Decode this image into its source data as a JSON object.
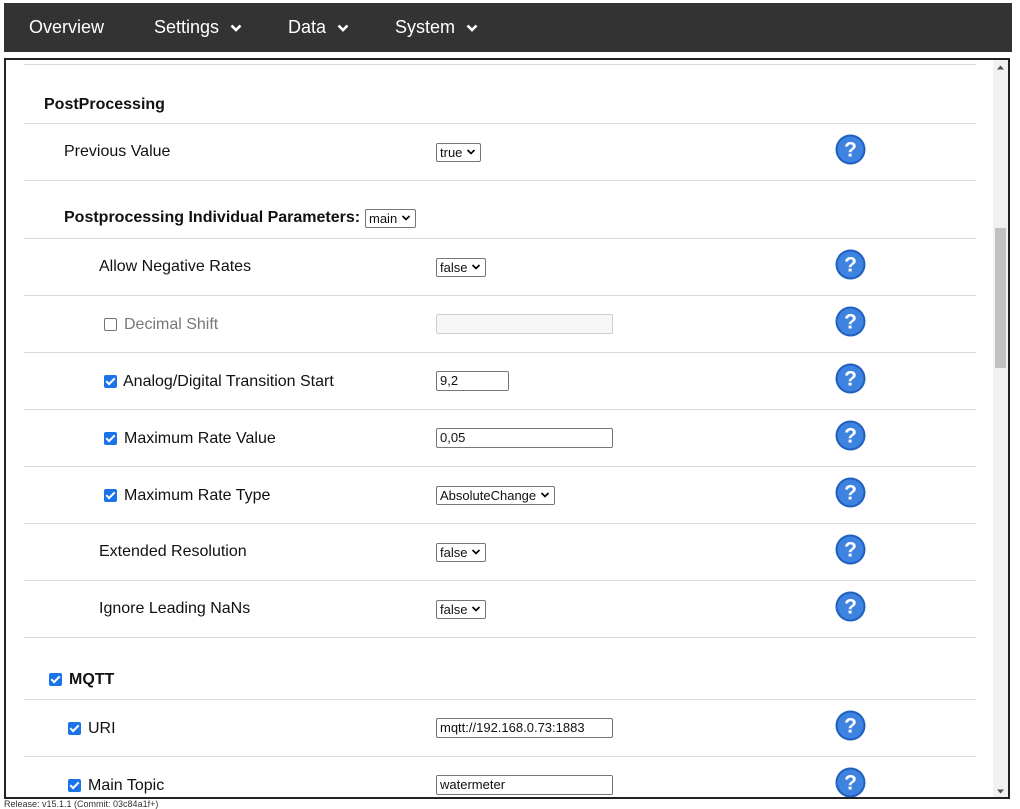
{
  "nav": {
    "items": [
      {
        "label": "Overview",
        "dropdown": false
      },
      {
        "label": "Settings",
        "dropdown": true
      },
      {
        "label": "Data",
        "dropdown": true
      },
      {
        "label": "System",
        "dropdown": true
      }
    ]
  },
  "postprocessing": {
    "title": "PostProcessing",
    "previous_value": {
      "label": "Previous Value",
      "value": "true"
    },
    "individual": {
      "label": "Postprocessing Individual Parameters:",
      "value": "main"
    },
    "allow_negative_rates": {
      "label": "Allow Negative Rates",
      "value": "false"
    },
    "decimal_shift": {
      "label": "Decimal Shift",
      "checked": false,
      "value": ""
    },
    "transition_start": {
      "label": "Analog/Digital Transition Start",
      "checked": true,
      "value": "9,2"
    },
    "max_rate_value": {
      "label": "Maximum Rate Value",
      "checked": true,
      "value": "0,05"
    },
    "max_rate_type": {
      "label": "Maximum Rate Type",
      "checked": true,
      "value": "AbsoluteChange"
    },
    "extended_resolution": {
      "label": "Extended Resolution",
      "value": "false"
    },
    "ignore_leading_nans": {
      "label": "Ignore Leading NaNs",
      "value": "false"
    }
  },
  "mqtt": {
    "title": "MQTT",
    "enabled": true,
    "uri": {
      "label": "URI",
      "checked": true,
      "value": "mqtt://192.168.0.73:1883"
    },
    "main_topic": {
      "label": "Main Topic",
      "checked": true,
      "value": "watermeter"
    }
  },
  "footer": {
    "release": "Release: v15.1.1 (Commit: 03c84a1f+)"
  },
  "colors": {
    "nav_bg": "#333333",
    "help_blue": "#1f5fc0",
    "checkbox_blue": "#1a73e8"
  },
  "icons": {
    "help": "question-circle-icon",
    "chevron": "chevron-down-icon"
  }
}
